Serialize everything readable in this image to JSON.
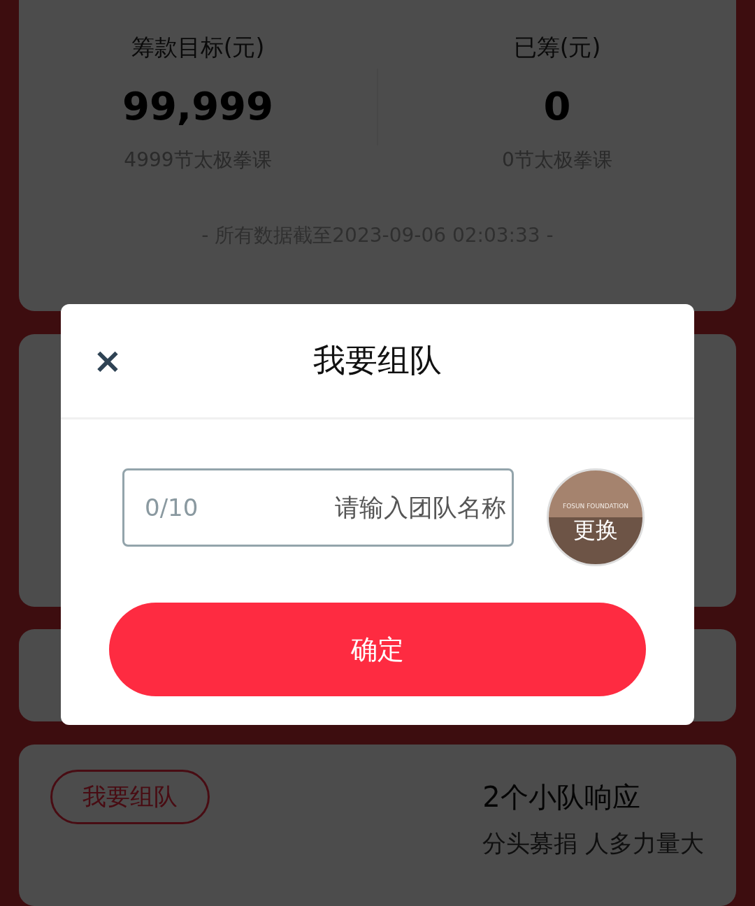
{
  "stats": [
    {
      "label": "筹款目标(元)",
      "value": "99,999",
      "note": "4999节太极拳课"
    },
    {
      "label": "已筹(元)",
      "value": "0",
      "note": "0节太极拳课"
    }
  ],
  "data_time": "- 所有数据截至2023-09-06 02:03:33 -",
  "team_card": {
    "title": "2个小队响应",
    "subtitle": "分头募捐 人多力量大",
    "button": "我要组队"
  },
  "modal": {
    "title": "我要组队",
    "close": "×",
    "input": {
      "placeholder": "请输入团队名称",
      "count": "0/10"
    },
    "avatar": {
      "brand": "FOSUN FOUNDATION",
      "action": "更换"
    },
    "confirm": "确定"
  }
}
